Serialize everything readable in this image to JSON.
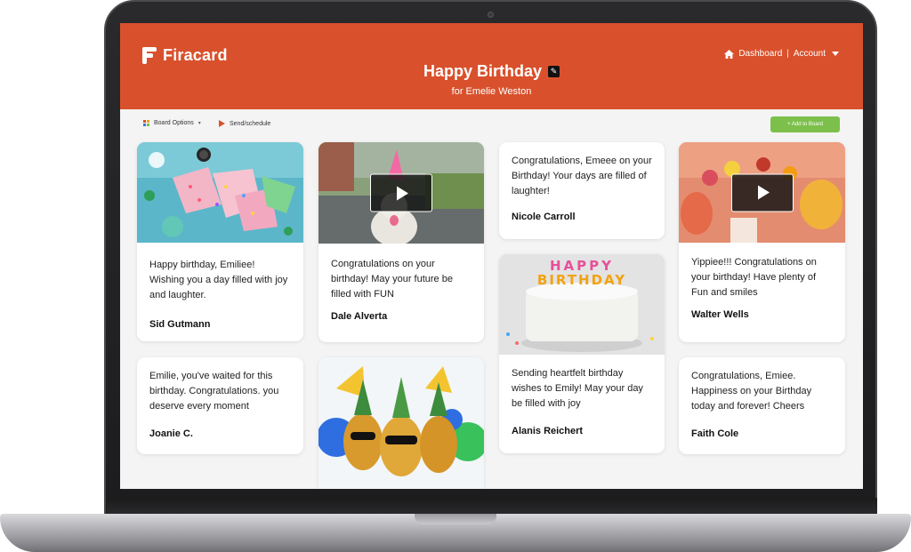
{
  "app": {
    "logo_text": "Firacard"
  },
  "header": {
    "title": "Happy Birthday",
    "subtitle": "for Emelie Weston",
    "nav": {
      "dashboard": "Dashboard",
      "separator": "|",
      "account": "Account"
    }
  },
  "toolbar": {
    "board_options": "Board Options",
    "send_schedule": "Send/schedule",
    "add_to_board": "+ Add to Board"
  },
  "cards": [
    {
      "message": "Happy birthday, Emiliee! Wishing you a day filled with joy and laughter.",
      "author": "Sid Gutmann",
      "media": "party-hats-photo"
    },
    {
      "message": "Congratulations on your birthday! May your future be filled with FUN",
      "author": "Dale Alverta",
      "media": "dog-party-video"
    },
    {
      "message": "Congratulations, Emeee on your Birthday!  Your days are filled of laughter!",
      "author": "Nicole Carroll",
      "media": ""
    },
    {
      "message": "Yippiee!!! Congratulations on your  birthday! Have plenty of Fun and smiles",
      "author": "Walter Wells",
      "media": "balloons-video"
    },
    {
      "message": "Sending heartfelt birthday wishes to Emily! May your day be filled with joy",
      "author": "Alanis Reichert",
      "media": "birthday-cake-photo",
      "cake_text_1": "HAPPY",
      "cake_text_2": "BIRTHDAY"
    },
    {
      "message": "Emilie, you've waited for this birthday. Congratulations. you deserve every moment",
      "author": "Joanie C.",
      "media": ""
    },
    {
      "message": "",
      "author": "",
      "media": "pineapples-party-photo"
    },
    {
      "message": "Congratulations, Emiee. Happiness on your Birthday today and forever! Cheers",
      "author": "Faith Cole",
      "media": ""
    }
  ],
  "colors": {
    "header": "#d9512c",
    "add_button": "#7cc04b",
    "background": "#f4f4f4"
  }
}
